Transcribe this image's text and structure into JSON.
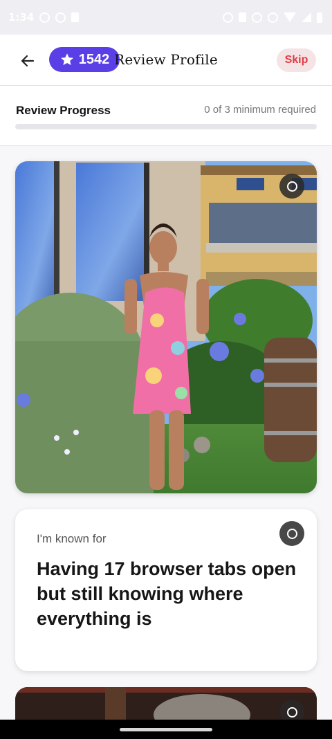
{
  "status_bar": {
    "time": "1:34",
    "left_icons": [
      "notification-circle-icon",
      "notification-circle-icon",
      "sd-card-icon"
    ],
    "right_icons": [
      "nfc-icon",
      "nfc-icon",
      "vibrate-icon",
      "dnd-icon",
      "wifi-icon",
      "signal-icon",
      "battery-icon"
    ]
  },
  "header": {
    "back_icon": "arrow-left-icon",
    "points_icon": "star-icon",
    "points": "1542",
    "title": "Review Profile",
    "skip_label": "Skip",
    "accent_color": "#5a3fe6",
    "skip_color": "#e23b45"
  },
  "progress": {
    "label": "Review Progress",
    "count_text": "0 of 3 minimum required",
    "fraction": 0
  },
  "cards": [
    {
      "type": "photo",
      "select_icon": "select-circle-icon"
    },
    {
      "type": "prompt",
      "label": "I'm known for",
      "answer": "Having 17 browser tabs open but still knowing where everything is",
      "select_icon": "select-circle-icon"
    },
    {
      "type": "photo",
      "select_icon": "select-circle-icon"
    }
  ]
}
